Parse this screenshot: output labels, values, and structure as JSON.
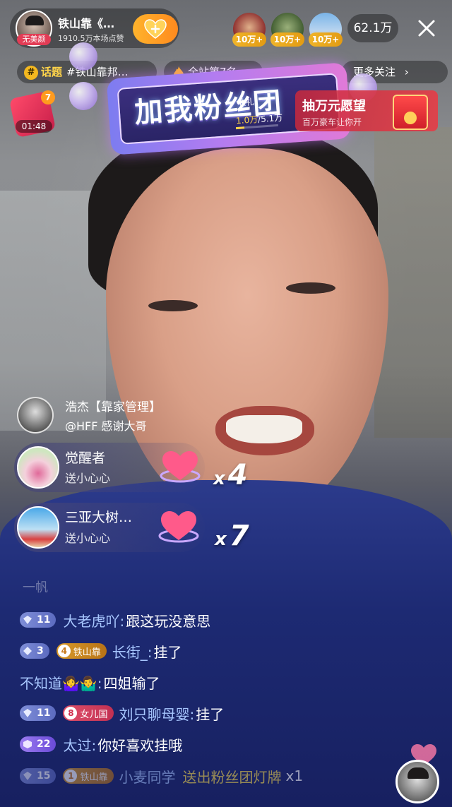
{
  "host": {
    "name": "铁山靠《…",
    "likes": "1910.5万本场点赞",
    "beauty_tag": "无美颜"
  },
  "viewers": [
    {
      "badge": "10万+"
    },
    {
      "badge": "10万+"
    },
    {
      "badge": "10万+"
    }
  ],
  "online_count": "62.1万",
  "topic": {
    "keyword": "话题",
    "text": "#铁山靠邦…"
  },
  "rank": "全站第7名",
  "more_follow": "更多关注",
  "fan_club": {
    "title": "加我粉丝团",
    "gift_label": "收礼",
    "progress_current": "1.0万",
    "progress_total": "/5.1万",
    "progress_fraction": 0.2
  },
  "wish": {
    "title": "抽万元愿望",
    "subtitle": "百万豪车让你开"
  },
  "gift_box": {
    "badge": "7",
    "timer": "01:48"
  },
  "greeting": {
    "name": "浩杰【靠家管理】",
    "message": "@HFF 感谢大哥"
  },
  "gift_events": [
    {
      "user": "觉醒者",
      "action": "送小心心",
      "combo": "4",
      "combo_prefix": "x"
    },
    {
      "user": "三亚大树…",
      "action": "送小心心",
      "combo": "7",
      "combo_prefix": "x"
    }
  ],
  "faded_comment": "一帆",
  "chat": [
    {
      "level": "11",
      "user": "大老虎吖:",
      "message": "跟这玩没意思"
    },
    {
      "level": "3",
      "club_level": "4",
      "club_name": "铁山靠",
      "user": "长街_:",
      "message": "挂了"
    },
    {
      "user": "不知道🤷‍♀️🤷‍♂️:",
      "message": "四姐输了"
    },
    {
      "level": "11",
      "club_level": "8",
      "club_name": "女儿国",
      "user": "刘只聊母婴:",
      "message": "挂了"
    },
    {
      "level": "22",
      "user": "太过:",
      "message": "你好喜欢挂哦"
    },
    {
      "level": "15",
      "club_level": "1",
      "club_name": "铁山靠",
      "user": "小麦同学",
      "message": "送出粉丝团灯牌",
      "suffix": "x1"
    }
  ],
  "colors": {
    "follow": "#ffa22a",
    "username": "#a8c7ff",
    "highlight": "#ffe04a",
    "level_badge": "#6f7ed0"
  }
}
